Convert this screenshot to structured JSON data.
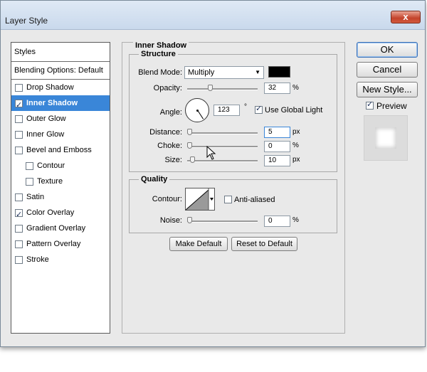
{
  "window": {
    "title": "Layer Style",
    "close_glyph": "x"
  },
  "styles_panel": {
    "header": "Styles",
    "blending_options": "Blending Options: Default",
    "items": [
      {
        "label": "Drop Shadow",
        "checked": false,
        "selected": false,
        "sub": false
      },
      {
        "label": "Inner Shadow",
        "checked": true,
        "selected": true,
        "sub": false
      },
      {
        "label": "Outer Glow",
        "checked": false,
        "selected": false,
        "sub": false
      },
      {
        "label": "Inner Glow",
        "checked": false,
        "selected": false,
        "sub": false
      },
      {
        "label": "Bevel and Emboss",
        "checked": false,
        "selected": false,
        "sub": false
      },
      {
        "label": "Contour",
        "checked": false,
        "selected": false,
        "sub": true
      },
      {
        "label": "Texture",
        "checked": false,
        "selected": false,
        "sub": true
      },
      {
        "label": "Satin",
        "checked": false,
        "selected": false,
        "sub": false
      },
      {
        "label": "Color Overlay",
        "checked": true,
        "selected": false,
        "sub": false
      },
      {
        "label": "Gradient Overlay",
        "checked": false,
        "selected": false,
        "sub": false
      },
      {
        "label": "Pattern Overlay",
        "checked": false,
        "selected": false,
        "sub": false
      },
      {
        "label": "Stroke",
        "checked": false,
        "selected": false,
        "sub": false
      }
    ]
  },
  "inner_shadow": {
    "section_title": "Inner Shadow",
    "structure": {
      "title": "Structure",
      "blend_mode_label": "Blend Mode:",
      "blend_mode_value": "Multiply",
      "shadow_color": "#000000",
      "opacity_label": "Opacity:",
      "opacity_value": "32",
      "opacity_unit": "%",
      "opacity_fraction": 0.32,
      "angle_label": "Angle:",
      "angle_value": "123",
      "angle_unit": "°",
      "use_global_light_label": "Use Global Light",
      "use_global_light_checked": true,
      "distance_label": "Distance:",
      "distance_value": "5",
      "distance_unit": "px",
      "distance_fraction": 0.0,
      "choke_label": "Choke:",
      "choke_value": "0",
      "choke_unit": "%",
      "choke_fraction": 0.0,
      "size_label": "Size:",
      "size_value": "10",
      "size_unit": "px",
      "size_fraction": 0.04
    },
    "quality": {
      "title": "Quality",
      "contour_label": "Contour:",
      "anti_aliased_label": "Anti-aliased",
      "anti_aliased_checked": false,
      "noise_label": "Noise:",
      "noise_value": "0",
      "noise_unit": "%",
      "noise_fraction": 0.0
    },
    "make_default_label": "Make Default",
    "reset_to_default_label": "Reset to Default"
  },
  "actions": {
    "ok_label": "OK",
    "cancel_label": "Cancel",
    "new_style_label": "New Style...",
    "preview_label": "Preview",
    "preview_checked": true
  },
  "colors": {
    "selection": "#3a86d8",
    "window_bg": "#e9e9e9"
  }
}
